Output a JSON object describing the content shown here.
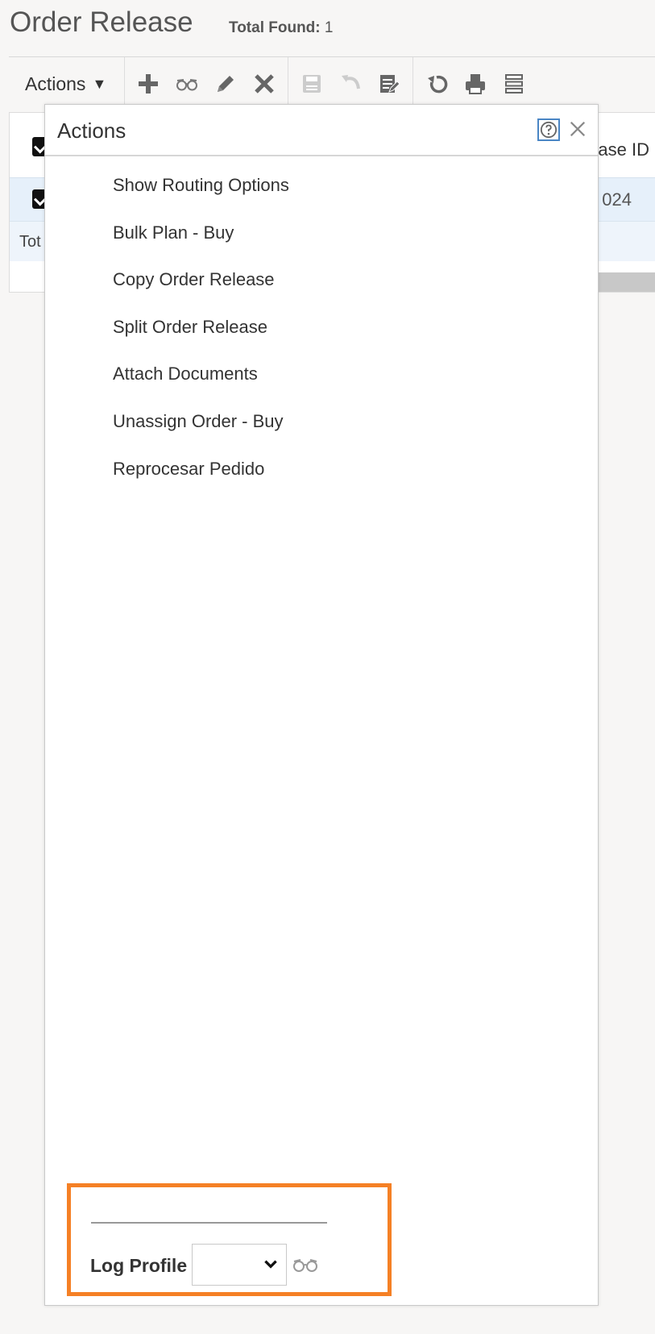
{
  "page": {
    "title": "Order Release",
    "total_found_label": "Total Found:",
    "total_found_value": "1"
  },
  "toolbar": {
    "actions_label": "Actions",
    "icons": [
      "plus-icon",
      "glasses-icon",
      "pencil-icon",
      "delete-icon",
      "save-icon",
      "undo-icon",
      "edit-doc-icon",
      "refresh-icon",
      "print-icon",
      "list-icon"
    ]
  },
  "grid": {
    "column_header_partial": "ase ID",
    "row_value_partial": "024",
    "total_label_partial": "Tot"
  },
  "actions_panel": {
    "title": "Actions",
    "items": [
      "Show Routing Options",
      "Bulk Plan - Buy",
      "Copy Order Release",
      "Split Order Release",
      "Attach Documents",
      "Unassign Order - Buy",
      "Reprocesar Pedido"
    ],
    "log_profile_label": "Log Profile",
    "log_profile_value": ""
  },
  "colors": {
    "highlight_border": "#f58025",
    "help_border": "#4a86c5",
    "selected_row": "#e6f0fa"
  }
}
